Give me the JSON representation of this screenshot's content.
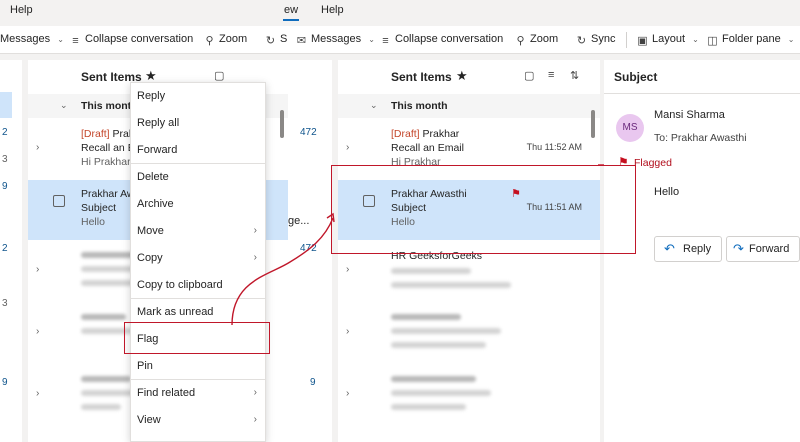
{
  "menubar": {
    "help1": "Help",
    "view_fragment": "ew",
    "help2": "Help"
  },
  "toolbar": {
    "messages_left": "Messages",
    "collapse_left": "Collapse conversation",
    "zoom_left": "Zoom",
    "sync_left_fragment": "S",
    "messages_right": "Messages",
    "collapse_right": "Collapse conversation",
    "zoom_right": "Zoom",
    "sync_right": "Sync",
    "layout": "Layout",
    "folder_pane": "Folder pane"
  },
  "left_pane": {
    "title": "Sent Items",
    "group": "This month",
    "counts": [
      "472",
      "472"
    ],
    "side_numbers": [
      "2",
      "3",
      "9",
      "2",
      "3",
      "9",
      "9"
    ],
    "msg1": {
      "line1_prefix": "[Draft]",
      "line1": "Prakh",
      "line2": "Recall an E",
      "line3": "Hi Prakhar"
    },
    "msg2": {
      "line1": "Prakhar Awa",
      "line2": "Subject",
      "line3": "Hello"
    },
    "fragment": "ge..."
  },
  "context_menu": {
    "items": [
      "Reply",
      "Reply all",
      "Forward",
      "Delete",
      "Archive",
      "Move",
      "Copy",
      "Copy to clipboard",
      "Mark as unread",
      "Flag",
      "Pin",
      "Find related",
      "View"
    ]
  },
  "middle_pane": {
    "title": "Sent Items",
    "group": "This month",
    "msg1": {
      "line1_prefix": "[Draft]",
      "line1": "Prakhar",
      "line2": "Recall an Email",
      "line3": "Hi Prakhar",
      "time": "Thu 11:52 AM"
    },
    "msg2": {
      "line1": "Prakhar Awasthi",
      "line2": "Subject",
      "line3": "Hello",
      "time": "Thu 11:51 AM"
    },
    "msg3": {
      "line1": "HR GeeksforGeeks"
    }
  },
  "reading_pane": {
    "subject": "Subject",
    "avatar_initials": "MS",
    "sender": "Mansi Sharma",
    "to": "To:  Prakhar Awasthi",
    "flag_status": "Flagged",
    "body": "Hello",
    "reply": "Reply",
    "forward": "Forward"
  },
  "colors": {
    "accent": "#0f6cbd",
    "selection": "#cfe4fa",
    "flag": "#c50f1f",
    "highlight_box": "#c0172a",
    "draft": "#c4462a"
  },
  "icons": [
    "star-icon",
    "flag-icon",
    "filter-icon",
    "sort-icon",
    "reply-icon",
    "forward-icon",
    "chevron-right-icon",
    "chevron-down-icon"
  ]
}
